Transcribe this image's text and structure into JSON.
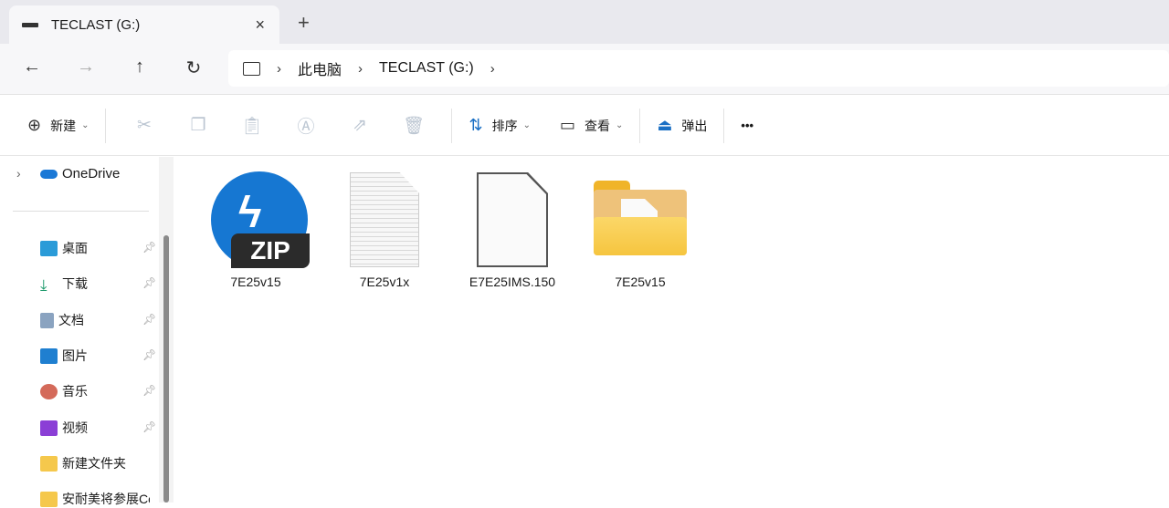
{
  "tab": {
    "title": "TECLAST (G:)",
    "close": "×",
    "new": "+"
  },
  "nav": {
    "back": "←",
    "forward": "→",
    "up": "↑",
    "refresh": "↻"
  },
  "breadcrumb": [
    "此电脑",
    "TECLAST (G:)"
  ],
  "toolbar": {
    "new": "新建",
    "sort": "排序",
    "view": "查看",
    "eject": "弹出",
    "more": "•••"
  },
  "sidebar": {
    "onedrive": "OneDrive",
    "items": [
      {
        "label": "桌面",
        "pinned": true
      },
      {
        "label": "下载",
        "pinned": true
      },
      {
        "label": "文档",
        "pinned": true
      },
      {
        "label": "图片",
        "pinned": true
      },
      {
        "label": "音乐",
        "pinned": true
      },
      {
        "label": "视频",
        "pinned": true
      },
      {
        "label": "新建文件夹"
      },
      {
        "label": "安耐美将参展Co"
      }
    ]
  },
  "files": [
    {
      "name": "7E25v15",
      "type": "zip",
      "badge": "ZIP"
    },
    {
      "name": "7E25v1x",
      "type": "text"
    },
    {
      "name": "E7E25IMS.150",
      "type": "blank"
    },
    {
      "name": "7E25v15",
      "type": "folder"
    }
  ]
}
